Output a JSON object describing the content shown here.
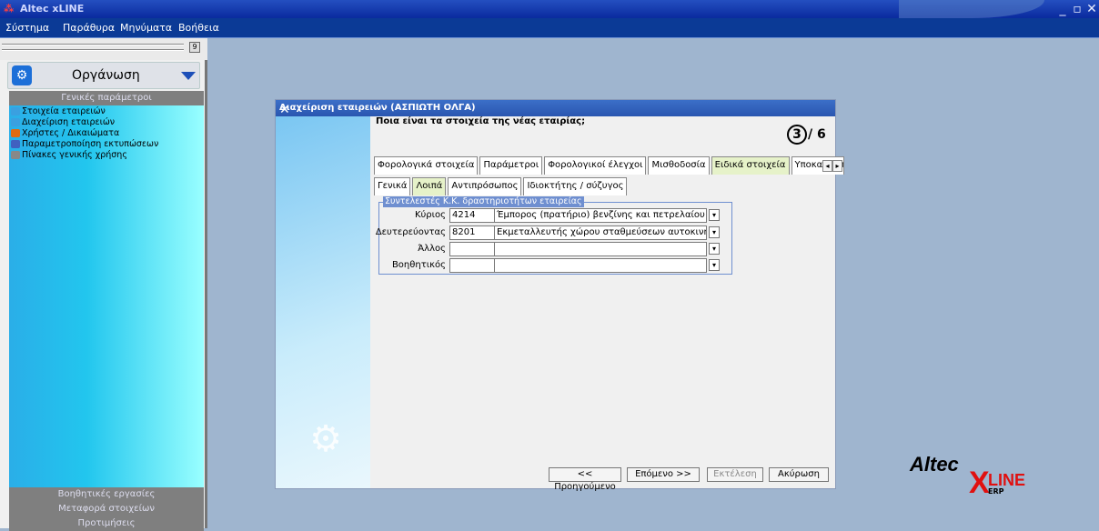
{
  "app": {
    "title": "Altec xLINE",
    "min": "_",
    "restore": "▫",
    "close": "✕"
  },
  "menu": [
    "Σύστημα",
    "Παράθυρα",
    "Μηνύματα",
    "Βοήθεια"
  ],
  "left_panel": {
    "pin_label": "9",
    "header_title": "Οργάνωση",
    "section_general": "Γενικές παράμετροι",
    "tree_items": [
      {
        "label": "Στοιχεία εταιρειών",
        "icon": "building-icon",
        "color": "#3aa0e0"
      },
      {
        "label": "Διαχείριση εταιρειών",
        "icon": "building-icon",
        "color": "#3aa0e0"
      },
      {
        "label": "Χρήστες / Δικαιώματα",
        "icon": "users-icon",
        "color": "#e06a10"
      },
      {
        "label": "Παραμετροποίηση εκτυπώσεων",
        "icon": "printer-icon",
        "color": "#4060c0"
      },
      {
        "label": "Πίνακες γενικής χρήσης",
        "icon": "table-icon",
        "color": "#888888"
      }
    ],
    "section_aux": "Βοηθητικές εργασίες",
    "section_transfer": "Μεταφορά στοιχείων",
    "section_prefs": "Προτιμήσεις"
  },
  "dialog": {
    "title": "Διαχείριση εταιρειών (ΑΣΠΙΩΤΗ ΟΛΓΑ)",
    "close": "✕",
    "question": "Ποια είναι τα στοιχεία της νέας εταιρίας;",
    "step_current": "3",
    "step_total": "/ 6",
    "tabs_top": [
      "Φορολογικά στοιχεία",
      "Παράμετροι",
      "Φορολογικοί έλεγχοι",
      "Μισθοδοσία",
      "Ειδικά στοιχεία",
      "Υποκαταστήμ"
    ],
    "tabs_top_active": 4,
    "tab_arrows": [
      "◂",
      "▸"
    ],
    "tabs_sub": [
      "Γενικά",
      "Λοιπά",
      "Αντιπρόσωπος",
      "Ιδιοκτήτης / σύζυγος"
    ],
    "tabs_sub_active": 1,
    "group_title": "Συντελεστές Κ.Κ. δραστηριοτήτων εταιρείας",
    "fields": [
      {
        "label": "Κύριος",
        "code": "4214",
        "desc": "Έμπορος (πρατήριο) βενζίνης και πετρελαίου κίνηση"
      },
      {
        "label": "Δευτερεύοντας",
        "code": "8201",
        "desc": "Εκμεταλλευτής χώρου σταθμεύσεων αυτοκινήτων ή"
      },
      {
        "label": "Άλλος",
        "code": "",
        "desc": ""
      },
      {
        "label": "Βοηθητικός",
        "code": "",
        "desc": ""
      }
    ],
    "lookup_glyph": "▾",
    "buttons": {
      "prev": "<< Προηγούμενο",
      "next": "Επόμενο >>",
      "execute": "Εκτέλεση",
      "cancel": "Ακύρωση"
    }
  },
  "logo": {
    "brand": "Altec",
    "x": "X",
    "line": "LINE",
    "erp": "ERP"
  }
}
